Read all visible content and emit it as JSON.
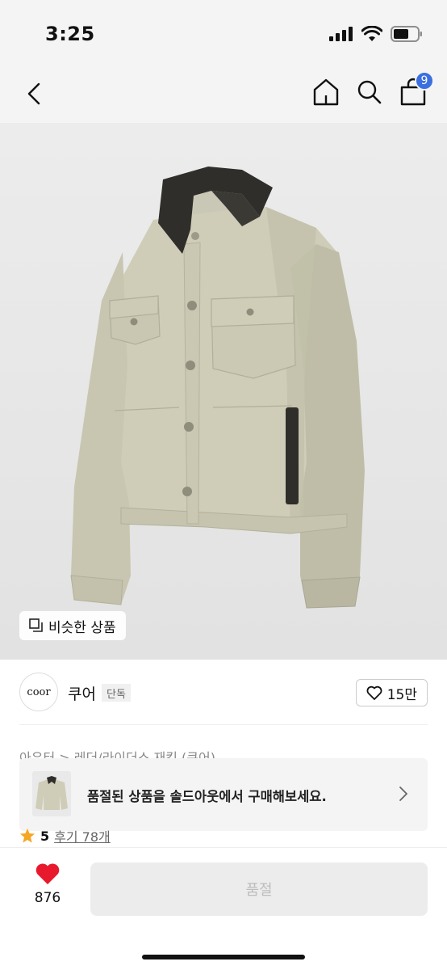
{
  "status_bar": {
    "time": "3:25"
  },
  "nav": {
    "cart_count": "9"
  },
  "product_image": {
    "similar_label": "비슷한 상품"
  },
  "brand": {
    "logo_text": "coor",
    "name": "쿠어",
    "tag": "단독",
    "likes": "15만"
  },
  "category": {
    "path": "아우터 > 레더/라이더스 재킷 (쿠어)"
  },
  "soldout_banner": {
    "message": "품절된 상품을 솔드아웃에서 구매해보세요."
  },
  "rating": {
    "score": "5",
    "reviews": "후기 78개"
  },
  "bottom_bar": {
    "wish_count": "876",
    "buy_label": "품절"
  },
  "colors": {
    "accent_blue": "#3b6fe0",
    "heart_red": "#e8192c",
    "star": "#f5a623"
  }
}
